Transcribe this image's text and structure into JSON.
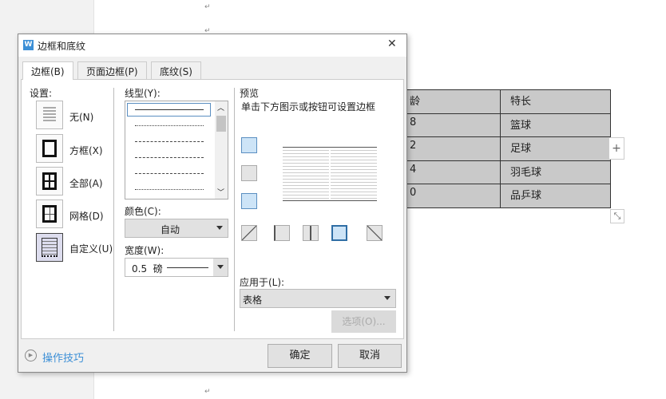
{
  "document": {
    "table": [
      [
        "龄",
        "特长"
      ],
      [
        "8",
        "篮球"
      ],
      [
        "2",
        "足球"
      ],
      [
        "4",
        "羽毛球"
      ],
      [
        "0",
        "品乒球"
      ]
    ],
    "add_row_symbol": "+",
    "resize_symbol": "⤡"
  },
  "dialog": {
    "title": "边框和底纹",
    "close_symbol": "✕",
    "tabs": [
      {
        "label": "边框(B)"
      },
      {
        "label": "页面边框(P)"
      },
      {
        "label": "底纹(S)"
      }
    ],
    "settings": {
      "label": "设置:",
      "items": [
        {
          "label": "无(N)"
        },
        {
          "label": "方框(X)"
        },
        {
          "label": "全部(A)"
        },
        {
          "label": "网格(D)"
        },
        {
          "label": "自定义(U)"
        }
      ]
    },
    "line_style": {
      "label": "线型(Y):"
    },
    "color": {
      "label": "颜色(C):",
      "value": "自动"
    },
    "width": {
      "label": "宽度(W):",
      "value": "0.5  磅"
    },
    "preview": {
      "label": "预览",
      "hint": "单击下方图示或按钮可设置边框"
    },
    "apply_to": {
      "label": "应用于(L):",
      "value": "表格"
    },
    "options_button": "选项(O)...",
    "tips_link": "操作技巧",
    "ok_button": "确定",
    "cancel_button": "取消"
  },
  "colors": {
    "accent": "#3c8fd6",
    "table_fill": "#c9c9c9"
  }
}
